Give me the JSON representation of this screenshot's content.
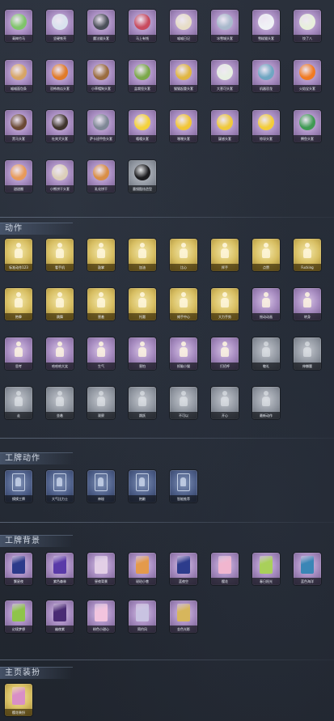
{
  "sections": [
    {
      "title": "",
      "items": [
        {
          "label": "青梅竹马",
          "tone": "purple",
          "art": "#7fc46a"
        },
        {
          "label": "坚硬铁壳",
          "tone": "purple",
          "art": "#d9e3ee"
        },
        {
          "label": "魔法猫头套",
          "tone": "purple",
          "art": "#4b4f59"
        },
        {
          "label": "马上有钱",
          "tone": "purple",
          "art": "#c84b5e"
        },
        {
          "label": "喵喵日记",
          "tone": "purple",
          "art": "#e7ddc7"
        },
        {
          "label": "冰雪城头套",
          "tone": "purple",
          "art": "#a9b9cc"
        },
        {
          "label": "雪糕猫头套",
          "tone": "purple",
          "art": "#f0f2f6"
        },
        {
          "label": "饺了八",
          "tone": "purple",
          "art": "#e8f0dc"
        },
        {
          "label": "喵喵面包条",
          "tone": "purple",
          "art": "#d7a565"
        },
        {
          "label": "恐怖南瓜头套",
          "tone": "purple",
          "art": "#e07b2a"
        },
        {
          "label": "小草帽狗头套",
          "tone": "purple",
          "art": "#9a6c3f"
        },
        {
          "label": "盆栽怪头套",
          "tone": "purple",
          "art": "#7ba84a"
        },
        {
          "label": "猫猫起重头套",
          "tone": "purple",
          "art": "#e0b642"
        },
        {
          "label": "大葱可头套",
          "tone": "purple",
          "art": "#e7efe3"
        },
        {
          "label": "机器恐龙",
          "tone": "purple",
          "art": "#6fa6c2"
        },
        {
          "label": "火焰宝头套",
          "tone": "purple",
          "art": "#f07b23"
        },
        {
          "label": "黑马头套",
          "tone": "purple",
          "art": "#6a4934"
        },
        {
          "label": "杜宾犬头套",
          "tone": "purple",
          "art": "#3f342c"
        },
        {
          "label": "萨卡班甲鱼头套",
          "tone": "purple",
          "art": "#7e8795"
        },
        {
          "label": "嘻嘻头套",
          "tone": "purple",
          "art": "#f4d23c"
        },
        {
          "label": "嘿嘿头套",
          "tone": "purple",
          "art": "#f2c636"
        },
        {
          "label": "疑惑头套",
          "tone": "purple",
          "art": "#efc93c"
        },
        {
          "label": "惊讶头套",
          "tone": "purple",
          "art": "#f3cd39"
        },
        {
          "label": "鳄鱼头套",
          "tone": "purple",
          "art": "#3f9a53"
        },
        {
          "label": "甜甜圈",
          "tone": "purple",
          "art": "#e79a5a"
        },
        {
          "label": "小熊饼干头套",
          "tone": "purple",
          "art": "#dccfba"
        },
        {
          "label": "乳化饼干",
          "tone": "purple",
          "art": "#d98e45"
        },
        {
          "label": "墨镜酷炫造型",
          "tone": "grey",
          "art": "#1c1c1f"
        }
      ]
    },
    {
      "title": "动作",
      "items": [
        {
          "label": "标准动作123",
          "tone": "gold"
        },
        {
          "label": "看手机",
          "tone": "gold"
        },
        {
          "label": "鼓掌",
          "tone": "gold"
        },
        {
          "label": "加油",
          "tone": "gold"
        },
        {
          "label": "比心",
          "tone": "gold"
        },
        {
          "label": "挥手",
          "tone": "gold"
        },
        {
          "label": "点赞",
          "tone": "gold"
        },
        {
          "label": "Fucking",
          "tone": "gold"
        },
        {
          "label": "抱拳",
          "tone": "gold"
        },
        {
          "label": "跳舞",
          "tone": "gold"
        },
        {
          "label": "害羞",
          "tone": "gold"
        },
        {
          "label": "托腮",
          "tone": "gold"
        },
        {
          "label": "摊手中心",
          "tone": "gold"
        },
        {
          "label": "大力手势",
          "tone": "gold"
        },
        {
          "label": "摇动动画",
          "tone": "purple"
        },
        {
          "label": "转身",
          "tone": "purple"
        },
        {
          "label": "思考",
          "tone": "purple"
        },
        {
          "label": "哈哈哈大笑",
          "tone": "purple"
        },
        {
          "label": "生气",
          "tone": "purple"
        },
        {
          "label": "害怕",
          "tone": "purple"
        },
        {
          "label": "抓脑小猫",
          "tone": "purple"
        },
        {
          "label": "打招呼",
          "tone": "purple"
        },
        {
          "label": "敬礼",
          "tone": "grey"
        },
        {
          "label": "伸懒腰",
          "tone": "grey"
        },
        {
          "label": "走",
          "tone": "grey"
        },
        {
          "label": "坐着",
          "tone": "grey"
        },
        {
          "label": "观察",
          "tone": "grey"
        },
        {
          "label": "跳跃",
          "tone": "grey"
        },
        {
          "label": "不可以",
          "tone": "grey"
        },
        {
          "label": "开心",
          "tone": "grey"
        },
        {
          "label": "最新动作",
          "tone": "grey"
        }
      ]
    },
    {
      "title": "工牌动作",
      "items": [
        {
          "label": "摸摸工牌",
          "tone": "navy"
        },
        {
          "label": "大气比力士",
          "tone": "navy"
        },
        {
          "label": "神秘",
          "tone": "navy"
        },
        {
          "label": "抱歉",
          "tone": "navy"
        },
        {
          "label": "智能推荐",
          "tone": "navy"
        }
      ]
    },
    {
      "title": "工牌背景",
      "items": [
        {
          "label": "繁星夜",
          "tone": "purple",
          "art": "#2c3a8a"
        },
        {
          "label": "紫色森林",
          "tone": "purple",
          "art": "#5a3aa8"
        },
        {
          "label": "昼夜背景",
          "tone": "purple",
          "art": "#e3cfe6"
        },
        {
          "label": "琥珀小巷",
          "tone": "purple",
          "art": "#e49a4b"
        },
        {
          "label": "蓝夜空",
          "tone": "purple",
          "art": "#2d3c8c"
        },
        {
          "label": "樱花",
          "tone": "purple",
          "art": "#f1b6cf"
        },
        {
          "label": "春日阳光",
          "tone": "purple",
          "art": "#a9d05a"
        },
        {
          "label": "蓝色海洋",
          "tone": "purple",
          "art": "#3a86b6"
        },
        {
          "label": "幻境梦想",
          "tone": "purple",
          "art": "#8fc44b"
        },
        {
          "label": "幽夜紫",
          "tone": "purple",
          "art": "#4a2c74"
        },
        {
          "label": "粉色小甜心",
          "tone": "purple",
          "art": "#f2c4de"
        },
        {
          "label": "简约风",
          "tone": "purple",
          "art": "#c9c3e2"
        },
        {
          "label": "金色光影",
          "tone": "purple",
          "art": "#d7b65c"
        }
      ]
    },
    {
      "title": "主页装扮",
      "items": [
        {
          "label": "樱花装扮",
          "tone": "gold",
          "art": "#d98fc6"
        }
      ]
    }
  ]
}
